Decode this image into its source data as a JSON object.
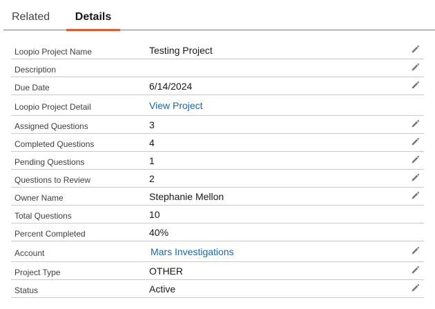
{
  "tabs": [
    {
      "label": "Related",
      "active": false
    },
    {
      "label": "Details",
      "active": true
    }
  ],
  "accent_color": "#e4592b",
  "link_color": "#0b6bba",
  "fields": [
    {
      "label": "Loopio Project Name",
      "value": "Testing Project",
      "is_link": false,
      "editable": true
    },
    {
      "label": "Description",
      "value": "",
      "is_link": false,
      "editable": true
    },
    {
      "label": "Due Date",
      "value": "6/14/2024",
      "is_link": false,
      "editable": true
    },
    {
      "label": "Loopio Project Detail",
      "value": "View Project",
      "is_link": true,
      "editable": false
    },
    {
      "label": "Assigned Questions",
      "value": "3",
      "is_link": false,
      "editable": true
    },
    {
      "label": "Completed Questions",
      "value": "4",
      "is_link": false,
      "editable": true
    },
    {
      "label": "Pending Questions",
      "value": "1",
      "is_link": false,
      "editable": true
    },
    {
      "label": "Questions to Review",
      "value": "2",
      "is_link": false,
      "editable": true
    },
    {
      "label": "Owner Name",
      "value": "Stephanie Mellon",
      "is_link": false,
      "editable": true
    },
    {
      "label": "Total Questions",
      "value": "10",
      "is_link": false,
      "editable": false
    },
    {
      "label": "Percent Completed",
      "value": "40%",
      "is_link": false,
      "editable": false
    },
    {
      "label": "Account",
      "value": "Mars Investigations",
      "is_link": true,
      "editable": true
    },
    {
      "label": "Project Type",
      "value": "OTHER",
      "is_link": false,
      "editable": true
    },
    {
      "label": "Status",
      "value": "Active",
      "is_link": false,
      "editable": true
    }
  ],
  "edit_icon": "pencil-icon"
}
